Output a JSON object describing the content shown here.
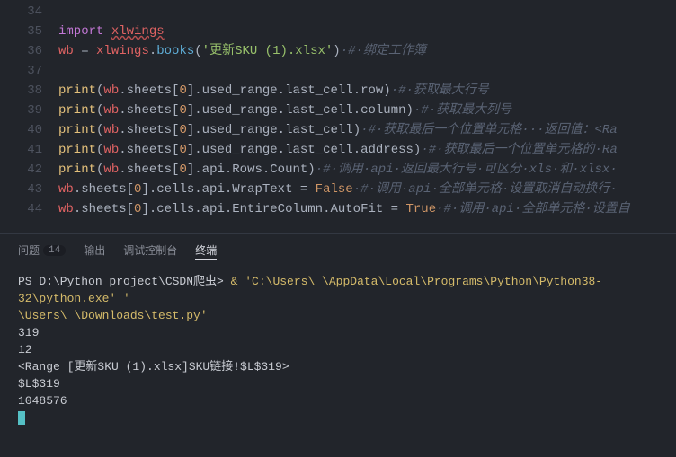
{
  "lines": [
    {
      "num": "34"
    },
    {
      "num": "35",
      "tokens": [
        {
          "cls": "k-import",
          "text": "import"
        },
        {
          "cls": "k-punct",
          "text": " "
        },
        {
          "cls": "k-module",
          "text": "xlwings",
          "err": true
        }
      ]
    },
    {
      "num": "36",
      "tokens": [
        {
          "cls": "k-var",
          "text": "wb"
        },
        {
          "cls": "k-op",
          "text": " = "
        },
        {
          "cls": "k-var",
          "text": "xlwings"
        },
        {
          "cls": "k-punct",
          "text": "."
        },
        {
          "cls": "k-func",
          "text": "books"
        },
        {
          "cls": "k-punct",
          "text": "("
        },
        {
          "cls": "k-string",
          "text": "'更新SKU (1).xlsx'"
        },
        {
          "cls": "k-punct",
          "text": ")"
        },
        {
          "cls": "k-comment",
          "text": "·#·绑定工作簿"
        }
      ]
    },
    {
      "num": "37"
    },
    {
      "num": "38",
      "tokens": [
        {
          "cls": "k-builtin",
          "text": "print"
        },
        {
          "cls": "k-punct",
          "text": "("
        },
        {
          "cls": "k-var",
          "text": "wb"
        },
        {
          "cls": "k-punct",
          "text": ".sheets["
        },
        {
          "cls": "k-num",
          "text": "0"
        },
        {
          "cls": "k-punct",
          "text": "].used_range.last_cell.row)"
        },
        {
          "cls": "k-comment",
          "text": "·#·获取最大行号"
        }
      ]
    },
    {
      "num": "39",
      "tokens": [
        {
          "cls": "k-builtin",
          "text": "print"
        },
        {
          "cls": "k-punct",
          "text": "("
        },
        {
          "cls": "k-var",
          "text": "wb"
        },
        {
          "cls": "k-punct",
          "text": ".sheets["
        },
        {
          "cls": "k-num",
          "text": "0"
        },
        {
          "cls": "k-punct",
          "text": "].used_range.last_cell.column)"
        },
        {
          "cls": "k-comment",
          "text": "·#·获取最大列号"
        }
      ]
    },
    {
      "num": "40",
      "tokens": [
        {
          "cls": "k-builtin",
          "text": "print"
        },
        {
          "cls": "k-punct",
          "text": "("
        },
        {
          "cls": "k-var",
          "text": "wb"
        },
        {
          "cls": "k-punct",
          "text": ".sheets["
        },
        {
          "cls": "k-num",
          "text": "0"
        },
        {
          "cls": "k-punct",
          "text": "].used_range.last_cell)"
        },
        {
          "cls": "k-comment",
          "text": "·#·获取最后一个位置单元格···返回值：<Ra"
        }
      ]
    },
    {
      "num": "41",
      "tokens": [
        {
          "cls": "k-builtin",
          "text": "print"
        },
        {
          "cls": "k-punct",
          "text": "("
        },
        {
          "cls": "k-var",
          "text": "wb"
        },
        {
          "cls": "k-punct",
          "text": ".sheets["
        },
        {
          "cls": "k-num",
          "text": "0"
        },
        {
          "cls": "k-punct",
          "text": "].used_range.last_cell.address)"
        },
        {
          "cls": "k-comment",
          "text": "·#·获取最后一个位置单元格的·Ra"
        }
      ]
    },
    {
      "num": "42",
      "tokens": [
        {
          "cls": "k-builtin",
          "text": "print"
        },
        {
          "cls": "k-punct",
          "text": "("
        },
        {
          "cls": "k-var",
          "text": "wb"
        },
        {
          "cls": "k-punct",
          "text": ".sheets["
        },
        {
          "cls": "k-num",
          "text": "0"
        },
        {
          "cls": "k-punct",
          "text": "].api.Rows.Count)"
        },
        {
          "cls": "k-comment",
          "text": "·#·调用·api·返回最大行号·可区分·xls·和·xlsx·"
        }
      ]
    },
    {
      "num": "43",
      "tokens": [
        {
          "cls": "k-var",
          "text": "wb"
        },
        {
          "cls": "k-punct",
          "text": ".sheets["
        },
        {
          "cls": "k-num",
          "text": "0"
        },
        {
          "cls": "k-punct",
          "text": "].cells.api.WrapText = "
        },
        {
          "cls": "k-bool",
          "text": "False"
        },
        {
          "cls": "k-comment",
          "text": "·#·调用·api·全部单元格·设置取消自动换行·"
        }
      ]
    },
    {
      "num": "44",
      "tokens": [
        {
          "cls": "k-var",
          "text": "wb"
        },
        {
          "cls": "k-punct",
          "text": ".sheets["
        },
        {
          "cls": "k-num",
          "text": "0"
        },
        {
          "cls": "k-punct",
          "text": "].cells.api.EntireColumn.AutoFit = "
        },
        {
          "cls": "k-bool",
          "text": "True"
        },
        {
          "cls": "k-comment",
          "text": "·#·调用·api·全部单元格·设置自"
        }
      ]
    }
  ],
  "panel": {
    "tabs": [
      {
        "label": "问题",
        "badge": "14",
        "active": false
      },
      {
        "label": "输出",
        "active": false
      },
      {
        "label": "调试控制台",
        "active": false
      },
      {
        "label": "终端",
        "active": true
      }
    ]
  },
  "terminal": {
    "prompt": "PS D:\\Python_project\\CSDN爬虫> ",
    "cmd1": " & 'C:\\Users\\     \\AppData\\Local\\Programs\\Python\\Python38-32\\python.exe' '",
    "cmd2": "\\Users\\     \\Downloads\\test.py'",
    "out": [
      "319",
      "12",
      "<Range [更新SKU (1).xlsx]SKU链接!$L$319>",
      "$L$319",
      "1048576"
    ]
  }
}
